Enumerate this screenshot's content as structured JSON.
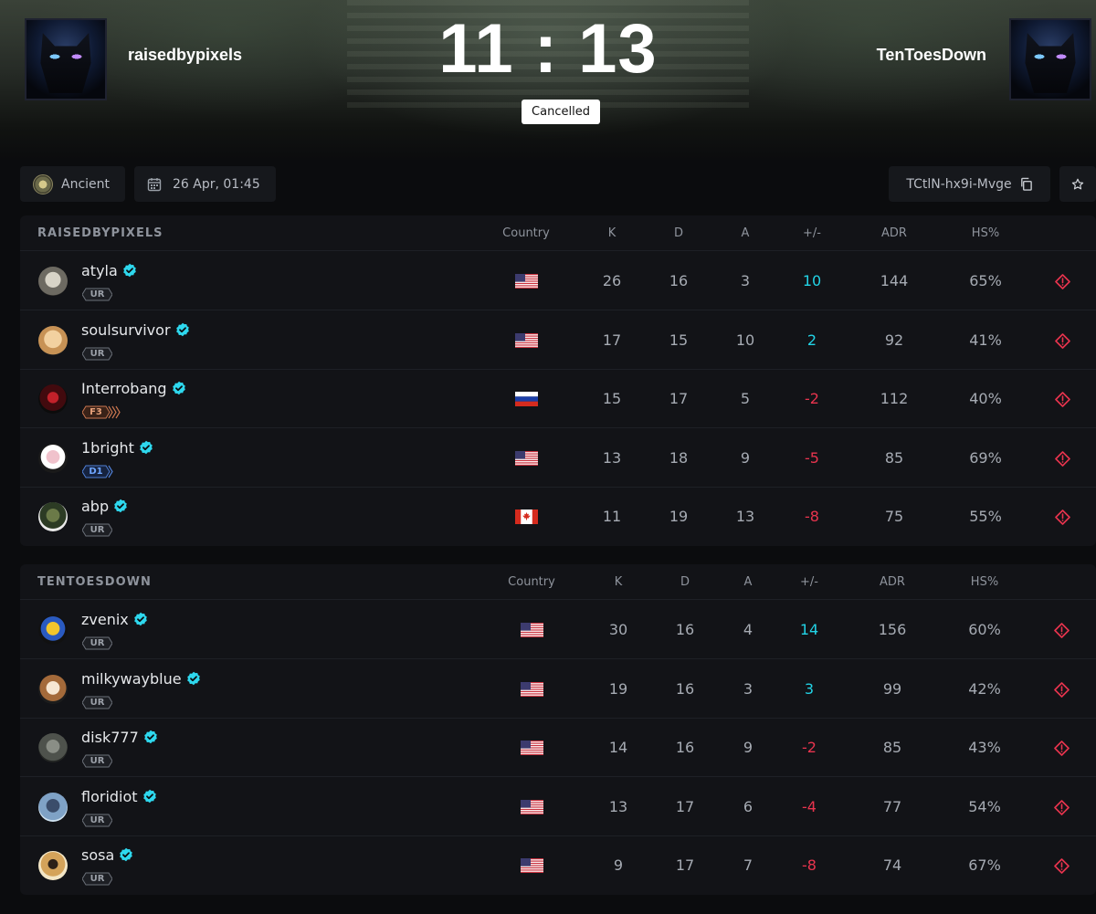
{
  "header": {
    "team_left": "raisedbypixels",
    "team_right": "TenToesDown",
    "score": "11 : 13",
    "status": "Cancelled"
  },
  "info": {
    "map": "Ancient",
    "date": "26 Apr, 01:45",
    "match_id": "TCtlN-hx9i-Mvge"
  },
  "columns": {
    "country": "Country",
    "k": "K",
    "d": "D",
    "a": "A",
    "diff": "+/-",
    "adr": "ADR",
    "hs": "HS%"
  },
  "colors": {
    "accent": "#22d3e6",
    "negative": "#e8344e",
    "panel": "#121317"
  },
  "teams": [
    {
      "label": "RAISEDBYPIXELS",
      "players": [
        {
          "name": "atyla",
          "rank": "UR",
          "country": "US",
          "k": "26",
          "d": "16",
          "a": "3",
          "diff": "10",
          "adr": "144",
          "hs": "65%"
        },
        {
          "name": "soulsurvivor",
          "rank": "UR",
          "country": "US",
          "k": "17",
          "d": "15",
          "a": "10",
          "diff": "2",
          "adr": "92",
          "hs": "41%"
        },
        {
          "name": "Interrobang",
          "rank": "F3",
          "country": "RU",
          "k": "15",
          "d": "17",
          "a": "5",
          "diff": "-2",
          "adr": "112",
          "hs": "40%"
        },
        {
          "name": "1bright",
          "rank": "D1",
          "country": "US",
          "k": "13",
          "d": "18",
          "a": "9",
          "diff": "-5",
          "adr": "85",
          "hs": "69%"
        },
        {
          "name": "abp",
          "rank": "UR",
          "country": "CA",
          "k": "11",
          "d": "19",
          "a": "13",
          "diff": "-8",
          "adr": "75",
          "hs": "55%"
        }
      ]
    },
    {
      "label": "TENTOESDOWN",
      "players": [
        {
          "name": "zvenix",
          "rank": "UR",
          "country": "US",
          "k": "30",
          "d": "16",
          "a": "4",
          "diff": "14",
          "adr": "156",
          "hs": "60%"
        },
        {
          "name": "milkywayblue",
          "rank": "UR",
          "country": "US",
          "k": "19",
          "d": "16",
          "a": "3",
          "diff": "3",
          "adr": "99",
          "hs": "42%"
        },
        {
          "name": "disk777",
          "rank": "UR",
          "country": "US",
          "k": "14",
          "d": "16",
          "a": "9",
          "diff": "-2",
          "adr": "85",
          "hs": "43%"
        },
        {
          "name": "floridiot",
          "rank": "UR",
          "country": "US",
          "k": "13",
          "d": "17",
          "a": "6",
          "diff": "-4",
          "adr": "77",
          "hs": "54%"
        },
        {
          "name": "sosa",
          "rank": "UR",
          "country": "US",
          "k": "9",
          "d": "17",
          "a": "7",
          "diff": "-8",
          "adr": "74",
          "hs": "67%"
        }
      ]
    }
  ]
}
